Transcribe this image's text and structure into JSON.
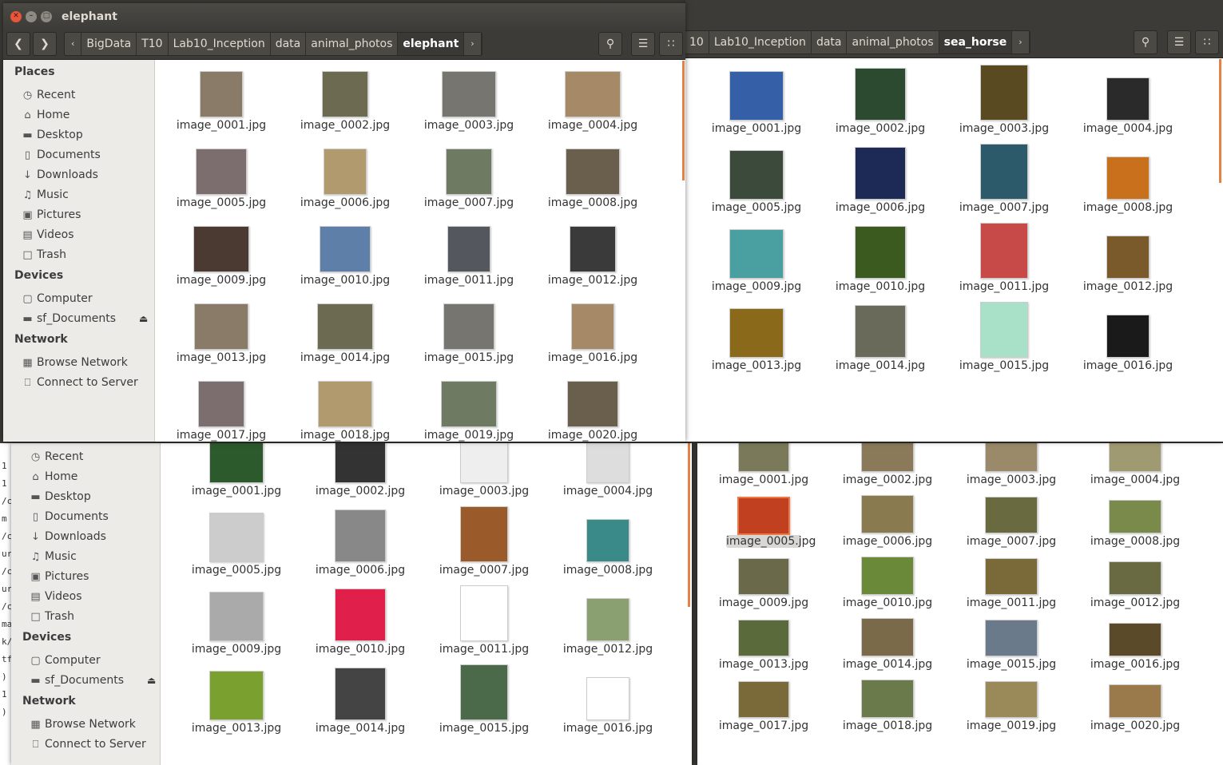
{
  "elephant_window": {
    "title": "elephant",
    "path": [
      "BigData",
      "T10",
      "Lab10_Inception",
      "data",
      "animal_photos",
      "elephant"
    ],
    "sidebar": {
      "places_label": "Places",
      "places": [
        {
          "label": "Recent",
          "icon": "clock-icon"
        },
        {
          "label": "Home",
          "icon": "home-icon"
        },
        {
          "label": "Desktop",
          "icon": "folder-icon"
        },
        {
          "label": "Documents",
          "icon": "document-icon"
        },
        {
          "label": "Downloads",
          "icon": "download-icon"
        },
        {
          "label": "Music",
          "icon": "music-icon"
        },
        {
          "label": "Pictures",
          "icon": "camera-icon"
        },
        {
          "label": "Videos",
          "icon": "film-icon"
        },
        {
          "label": "Trash",
          "icon": "trash-icon"
        }
      ],
      "devices_label": "Devices",
      "devices": [
        {
          "label": "Computer",
          "icon": "computer-icon"
        },
        {
          "label": "sf_Documents",
          "icon": "drive-icon"
        }
      ],
      "network_label": "Network",
      "network": [
        {
          "label": "Browse Network",
          "icon": "network-icon"
        },
        {
          "label": "Connect to Server",
          "icon": "server-icon"
        }
      ]
    },
    "files": [
      "image_0001.jpg",
      "image_0002.jpg",
      "image_0003.jpg",
      "image_0004.jpg",
      "image_0005.jpg",
      "image_0006.jpg",
      "image_0007.jpg",
      "image_0008.jpg",
      "image_0009.jpg",
      "image_0010.jpg",
      "image_0011.jpg",
      "image_0012.jpg",
      "image_0013.jpg",
      "image_0014.jpg",
      "image_0015.jpg",
      "image_0016.jpg",
      "image_0017.jpg",
      "image_0018.jpg",
      "image_0019.jpg",
      "image_0020.jpg"
    ]
  },
  "seahorse_window": {
    "path": [
      "10",
      "Lab10_Inception",
      "data",
      "animal_photos",
      "sea_horse"
    ],
    "files": [
      "image_0001.jpg",
      "image_0002.jpg",
      "image_0003.jpg",
      "image_0004.jpg",
      "image_0005.jpg",
      "image_0006.jpg",
      "image_0007.jpg",
      "image_0008.jpg",
      "image_0009.jpg",
      "image_0010.jpg",
      "image_0011.jpg",
      "image_0012.jpg",
      "image_0013.jpg",
      "image_0014.jpg",
      "image_0015.jpg",
      "image_0016.jpg"
    ]
  },
  "panda_window": {
    "sidebar": {
      "places": [
        {
          "label": "Recent",
          "icon": "clock-icon"
        },
        {
          "label": "Home",
          "icon": "home-icon"
        },
        {
          "label": "Desktop",
          "icon": "folder-icon"
        },
        {
          "label": "Documents",
          "icon": "document-icon"
        },
        {
          "label": "Downloads",
          "icon": "download-icon"
        },
        {
          "label": "Music",
          "icon": "music-icon"
        },
        {
          "label": "Pictures",
          "icon": "camera-icon"
        },
        {
          "label": "Videos",
          "icon": "film-icon"
        },
        {
          "label": "Trash",
          "icon": "trash-icon"
        }
      ],
      "devices_label": "Devices",
      "devices": [
        {
          "label": "Computer",
          "icon": "computer-icon"
        },
        {
          "label": "sf_Documents",
          "icon": "drive-icon"
        }
      ],
      "network_label": "Network",
      "network": [
        {
          "label": "Browse Network",
          "icon": "network-icon"
        },
        {
          "label": "Connect to Server",
          "icon": "server-icon"
        }
      ]
    },
    "files": [
      "image_0001.jpg",
      "image_0002.jpg",
      "image_0003.jpg",
      "image_0004.jpg",
      "image_0005.jpg",
      "image_0006.jpg",
      "image_0007.jpg",
      "image_0008.jpg",
      "image_0009.jpg",
      "image_0010.jpg",
      "image_0011.jpg",
      "image_0012.jpg",
      "image_0013.jpg",
      "image_0014.jpg",
      "image_0015.jpg",
      "image_0016.jpg"
    ]
  },
  "cheetah_window": {
    "files": [
      "image_0001.jpg",
      "image_0002.jpg",
      "image_0003.jpg",
      "image_0004.jpg",
      "image_0005.jpg",
      "image_0006.jpg",
      "image_0007.jpg",
      "image_0008.jpg",
      "image_0009.jpg",
      "image_0010.jpg",
      "image_0011.jpg",
      "image_0012.jpg",
      "image_0013.jpg",
      "image_0014.jpg",
      "image_0015.jpg",
      "image_0016.jpg",
      "image_0017.jpg",
      "image_0018.jpg",
      "image_0019.jpg",
      "image_0020.jpg"
    ],
    "selected_file": "image_0005.jpg"
  },
  "terminal_fragment": [
    "1",
    "1",
    "/c",
    "m",
    "/c",
    "ur",
    "/c",
    "ur",
    "/c",
    "ma",
    "k/",
    "tf",
    ")",
    "1",
    ")"
  ],
  "colors": {
    "accent": "#f07746",
    "titlebar": "#3c3b37",
    "sidebar": "#ecebe8"
  }
}
